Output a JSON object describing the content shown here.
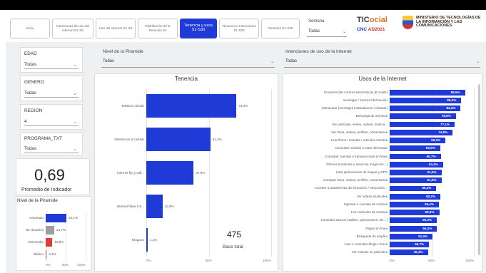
{
  "tabs": [
    {
      "label": "Inicio",
      "active": false
    },
    {
      "label": "Intenciones de uso del Internet S1-S5",
      "active": false
    },
    {
      "label": "Uso del Internet S1-S5",
      "active": false
    },
    {
      "label": "Distribución de la Tenencia S1",
      "active": false
    },
    {
      "label": "Tenencia y usos S1-S30",
      "active": true
    },
    {
      "label": "Tenencia e Intenciones S1-S30",
      "active": false
    },
    {
      "label": "Tenencia S1-S30",
      "active": false
    }
  ],
  "header": {
    "semana_label": "Semana",
    "semana_value": "Todas",
    "brand_title_main": "TIC",
    "brand_title_accent": "ocial",
    "brand_sub_a": "CNC",
    "brand_sub_b": "AD2021",
    "ministry": "MINISTERIO DE TECNOLOGÍAS DE LA INFORMACIÓN Y LAS COMUNICACIONES"
  },
  "filters": {
    "edad": {
      "label": "EDAD",
      "value": "Todas"
    },
    "genero": {
      "label": "GENERO",
      "value": "Todas"
    },
    "region": {
      "label": "REGION",
      "value": "4"
    },
    "programa": {
      "label": "PROGRAMA_TXT",
      "value": "Todas"
    },
    "piramide": {
      "label": "Nivel de la Piramide",
      "value": "Todas"
    },
    "intenciones": {
      "label": "Intenciones de uso de la Internet",
      "value": "Todas"
    }
  },
  "kpi": {
    "value": "0,69",
    "label": "Promedio de Indicador"
  },
  "total": {
    "value": "475",
    "label": "Base total"
  },
  "chart_data": [
    {
      "type": "bar",
      "orientation": "horizontal",
      "title": "Nivel de la Piramide",
      "categories": [
        "Avanzado",
        "No Usuarios",
        "Intermedio",
        "Básico"
      ],
      "values": [
        52.1,
        21.7,
        16.8,
        2.4
      ],
      "value_labels": [
        "52,1%",
        "21,7%",
        "16,8%",
        "2,4%"
      ],
      "colors": [
        "#1f3ad6",
        "#9e9e9e",
        "#e53935",
        "#e53935"
      ],
      "xticks": [
        "0%",
        "50%",
        "100%"
      ],
      "xlim": [
        0,
        100
      ]
    },
    {
      "type": "bar",
      "orientation": "horizontal",
      "title": "Tenencia",
      "categories": [
        "Telefono celular",
        "Internet en el celular",
        "Internet fijo y wifi...",
        "Internet fibra/ 0,5...",
        "Ninguno"
      ],
      "values": [
        72.2,
        51.3,
        37.9,
        12.9,
        1.1
      ],
      "value_labels": [
        "72,2%",
        "51,3%",
        "37,9%",
        "12,9%",
        "1,1%"
      ],
      "xticks": [
        "0%",
        "50%",
        "100%"
      ],
      "xlim": [
        0,
        100
      ]
    },
    {
      "type": "bar",
      "orientation": "horizontal",
      "title": "Usos de la Internet",
      "categories": [
        "Enviar/recibir correos electrónicos (E-mails)",
        "Investigar / buscar información",
        "Interactuar (mensajes instantáneos / chatear)",
        "Descarga de archivos",
        "Ver películas, series, videos, música...",
        "Ver fotos, videos, perfiles, comentarios",
        "Leer libros / revistas / artículos escritos",
        "Consultar noticias o estar informado",
        "Consultar cuentas o transacciones en línea",
        "Ofrecer productos y servicios (negocios...)",
        "Usar aplicaciones de mapas y GPS",
        "Comprar fotos, videos, perfiles, comentarios",
        "Acceder a plataformas de formación / educación...",
        "Ver videos musicales",
        "Ingresar a cuentas de noticias",
        "Leer artículos de noticias",
        "Consultar bancos (saldos, operaciones, etc...)",
        "Pagos en línea",
        "Búsqueda de empleo",
        "Leer o consultar blogs o foros",
        "Ver noticias en policiales"
      ],
      "values": [
        89.5,
        85.0,
        84.3,
        78.6,
        77.1,
        74.8,
        66.2,
        60.0,
        60.7,
        63.4,
        61.6,
        61.5,
        55.4,
        60.2,
        58.4,
        58.9,
        56.0,
        56.3,
        51.0,
        46.7,
        45.4
      ],
      "value_labels": [
        "89,5%",
        "85,0%",
        "84,3%",
        "78,6%",
        "77,1%",
        "74,8%",
        "66,2%",
        "60,0%",
        "60,7%",
        "63,4%",
        "61,6%",
        "61,5%",
        "55,4%",
        "60,2%",
        "58,4%",
        "58,9%",
        "56,0%",
        "56,3%",
        "51,0%",
        "46,7%",
        "45,4%"
      ],
      "xticks": [
        "0%",
        "50%",
        "100%"
      ],
      "xlim": [
        0,
        100
      ]
    }
  ]
}
